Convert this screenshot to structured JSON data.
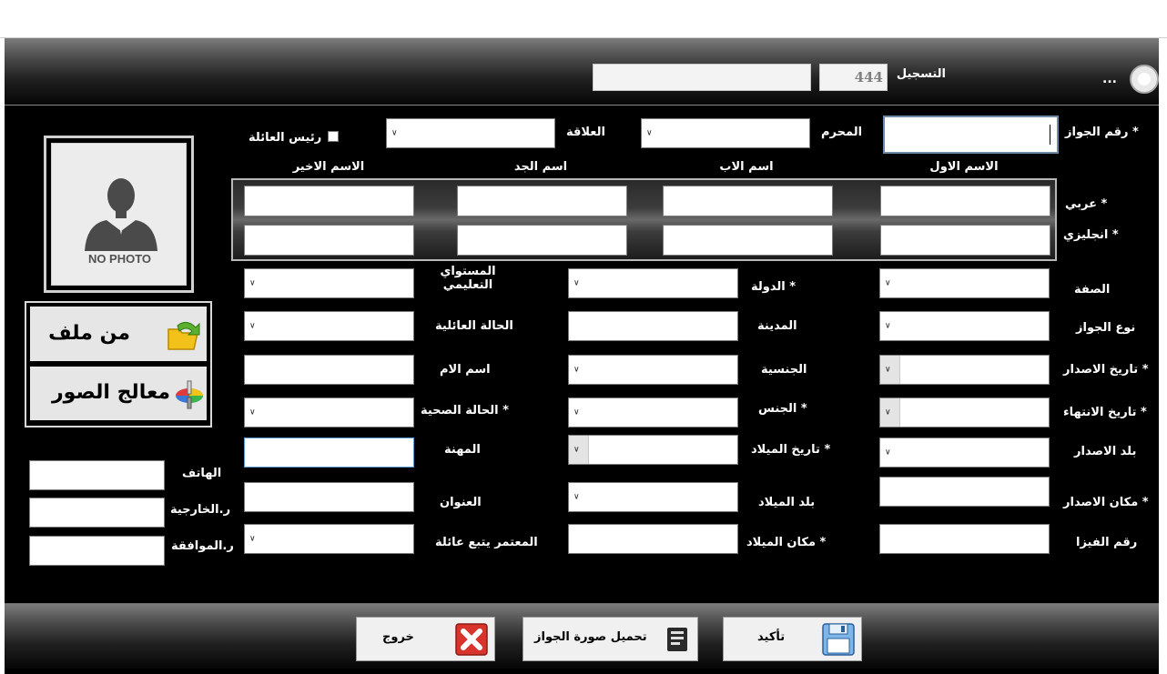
{
  "header": {
    "ellipsis": "...",
    "registration_label": "التسجيل",
    "registration_value": "444"
  },
  "top_row": {
    "passport_label": "رقم الجواز *",
    "muharram_label": "المحرم",
    "relation_label": "العلاقة",
    "family_head_label": "رئيس العائلة"
  },
  "name_headers": {
    "first": "الاسم الاول",
    "father": "اسم الاب",
    "grandfather": "اسم الجد",
    "last": "الاسم الاخير"
  },
  "name_rows": {
    "arabic": "عربي *",
    "english": "انجليزي *"
  },
  "fields": {
    "title": "الصفة",
    "passport_type": "نوع الجواز",
    "issue_date": "تاريخ الاصدار *",
    "expiry_date": "تاريخ الانتهاء *",
    "issue_country": "بلد الاصدار",
    "issue_place": "مكان الاصدار *",
    "visa_number": "رقم الفيزا",
    "country": "الدولة *",
    "city": "المدينة",
    "nationality": "الجنسية",
    "gender": "الجنس *",
    "birth_date": "تاريخ الميلاد *",
    "birth_country": "بلد الميلاد",
    "birth_place": "مكان الميلاد *",
    "education_line1": "المستواي",
    "education_line2": "التعليمي",
    "marital": "الحالة العائلية",
    "mother_name": "اسم الام",
    "health": "الحالة الصحية *",
    "profession": "المهنة",
    "address": "العنوان",
    "family_follower": "المعتمر يتبع عائلة"
  },
  "left_panel": {
    "no_photo": "NO PHOTO",
    "from_file": "من ملف",
    "image_processor": "معالج الصور",
    "phone": "الهاتف",
    "foreign_ref": "ر.الخارجية",
    "approval_ref": "ر.الموافقة"
  },
  "footer": {
    "confirm": "تأكيد",
    "upload_passport": "تحميل صورة الجواز",
    "exit": "خروج"
  },
  "colors": {
    "background": "#000000",
    "label": "#ffffff",
    "field": "#ffffff",
    "exit_red": "#d9342b"
  }
}
